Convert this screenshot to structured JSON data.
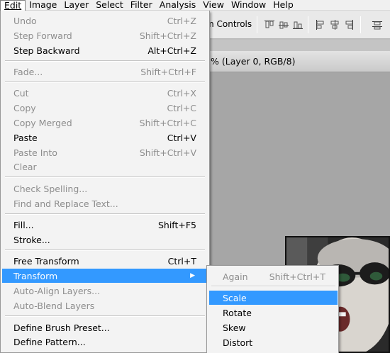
{
  "menubar": {
    "items": [
      {
        "label": "Edit",
        "mnemonic_underline": true
      },
      {
        "label": "Image"
      },
      {
        "label": "Layer"
      },
      {
        "label": "Select"
      },
      {
        "label": "Filter"
      },
      {
        "label": "Analysis"
      },
      {
        "label": "View"
      },
      {
        "label": "Window"
      },
      {
        "label": "Help"
      }
    ]
  },
  "options_bar": {
    "show_transform_controls_label": "m Controls",
    "align_icons": [
      "align-top-edges-icon",
      "align-vertical-centers-icon",
      "align-bottom-edges-icon",
      "align-left-edges-icon",
      "align-horizontal-centers-icon",
      "align-right-edges-icon",
      "distribute-top-edges-icon"
    ]
  },
  "document": {
    "title": "% (Layer 0, RGB/8)"
  },
  "edit_menu": {
    "items": [
      {
        "label": "Undo",
        "shortcut": "Ctrl+Z",
        "enabled": false
      },
      {
        "label": "Step Forward",
        "shortcut": "Shift+Ctrl+Z",
        "enabled": false
      },
      {
        "label": "Step Backward",
        "shortcut": "Alt+Ctrl+Z",
        "enabled": true
      },
      {
        "label": "Fade...",
        "shortcut": "Shift+Ctrl+F",
        "enabled": false
      },
      {
        "label": "Cut",
        "shortcut": "Ctrl+X",
        "enabled": false
      },
      {
        "label": "Copy",
        "shortcut": "Ctrl+C",
        "enabled": false
      },
      {
        "label": "Copy Merged",
        "shortcut": "Shift+Ctrl+C",
        "enabled": false
      },
      {
        "label": "Paste",
        "shortcut": "Ctrl+V",
        "enabled": true
      },
      {
        "label": "Paste Into",
        "shortcut": "Shift+Ctrl+V",
        "enabled": false
      },
      {
        "label": "Clear",
        "shortcut": "",
        "enabled": false
      },
      {
        "label": "Check Spelling...",
        "shortcut": "",
        "enabled": false
      },
      {
        "label": "Find and Replace Text...",
        "shortcut": "",
        "enabled": false
      },
      {
        "label": "Fill...",
        "shortcut": "Shift+F5",
        "enabled": true
      },
      {
        "label": "Stroke...",
        "shortcut": "",
        "enabled": true
      },
      {
        "label": "Free Transform",
        "shortcut": "Ctrl+T",
        "enabled": true
      },
      {
        "label": "Transform",
        "shortcut": "",
        "enabled": true,
        "selected": true,
        "submenu": true
      },
      {
        "label": "Auto-Align Layers...",
        "shortcut": "",
        "enabled": false
      },
      {
        "label": "Auto-Blend Layers",
        "shortcut": "",
        "enabled": false
      },
      {
        "label": "Define Brush Preset...",
        "shortcut": "",
        "enabled": true
      },
      {
        "label": "Define Pattern...",
        "shortcut": "",
        "enabled": true
      }
    ]
  },
  "transform_submenu": {
    "items": [
      {
        "label": "Again",
        "shortcut": "Shift+Ctrl+T",
        "enabled": false
      },
      {
        "label": "Scale",
        "shortcut": "",
        "enabled": true,
        "selected": true
      },
      {
        "label": "Rotate",
        "shortcut": "",
        "enabled": true
      },
      {
        "label": "Skew",
        "shortcut": "",
        "enabled": true
      },
      {
        "label": "Distort",
        "shortcut": "",
        "enabled": true
      }
    ]
  },
  "colors": {
    "menu_highlight": "#3399ff",
    "menu_bg": "#f3f3f3",
    "disabled_text": "#8d8d8d",
    "workspace_bg": "#a6a6a6"
  }
}
